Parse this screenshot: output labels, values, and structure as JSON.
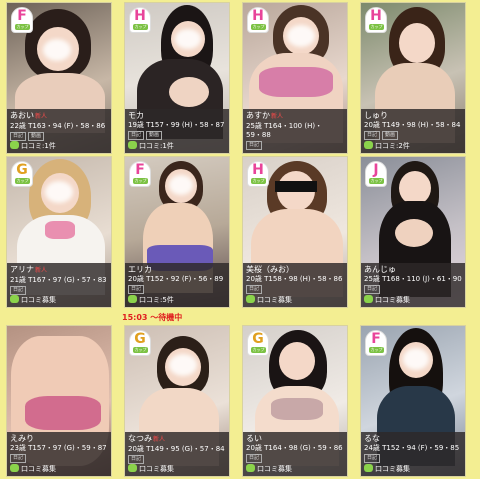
{
  "colors": {
    "background": "#f3ee92",
    "info_panel": "#3a3633",
    "badge_F": "#e8449a",
    "badge_G": "#e0a020",
    "badge_H": "#e8449a",
    "badge_J": "#e8449a",
    "new_mark": "#ff4a4a",
    "waiting": "#e02020"
  },
  "waiting_banner": {
    "text": "15:03 ～待機中"
  },
  "cast": [
    {
      "cup": "F",
      "cup_sub": "カップ",
      "name": "あおい",
      "new": "新人",
      "spec": "22歳 T163・94 (F)・58・86",
      "tags": [
        "日記",
        "動画"
      ],
      "reviews": "口コミ:1件"
    },
    {
      "cup": "H",
      "cup_sub": "カップ",
      "name": "モカ",
      "new": "",
      "spec": "19歳 T157・99 (H)・58・87",
      "tags": [
        "日記",
        "動画"
      ],
      "reviews": "口コミ:1件"
    },
    {
      "cup": "H",
      "cup_sub": "カップ",
      "name": "あすか",
      "new": "新人",
      "spec": "25歳 T164・100 (H)・59・88",
      "tags": [
        "日記"
      ],
      "reviews": ""
    },
    {
      "cup": "H",
      "cup_sub": "カップ",
      "name": "しゅり",
      "new": "",
      "spec": "20歳 T149・98 (H)・58・84",
      "tags": [
        "日記",
        "動画"
      ],
      "reviews": "口コミ:2件"
    },
    {
      "cup": "G",
      "cup_sub": "カップ",
      "name": "アリナ",
      "new": "新人",
      "spec": "21歳 T167・97 (G)・57・83",
      "tags": [
        "日記"
      ],
      "reviews": "口コミ募集"
    },
    {
      "cup": "F",
      "cup_sub": "カップ",
      "name": "エリカ",
      "new": "",
      "spec": "20歳 T152・92 (F)・56・89",
      "tags": [
        "日記"
      ],
      "reviews": "口コミ:5件"
    },
    {
      "cup": "H",
      "cup_sub": "カップ",
      "name": "美桜（みお）",
      "new": "",
      "spec": "20歳 T158・98 (H)・58・86",
      "tags": [
        "日記"
      ],
      "reviews": "口コミ募集"
    },
    {
      "cup": "J",
      "cup_sub": "カップ",
      "name": "あんじゅ",
      "new": "",
      "spec": "25歳 T168・110 (J)・61・90",
      "tags": [
        "日記"
      ],
      "reviews": "口コミ募集"
    },
    {
      "cup": "",
      "cup_sub": "",
      "name": "えみり",
      "new": "",
      "spec": "23歳 T157・97 (G)・59・87",
      "tags": [
        "日記"
      ],
      "reviews": "口コミ募集"
    },
    {
      "cup": "G",
      "cup_sub": "カップ",
      "name": "なつみ",
      "new": "新人",
      "spec": "20歳 T149・95 (G)・57・84",
      "tags": [
        "日記"
      ],
      "reviews": "口コミ募集"
    },
    {
      "cup": "G",
      "cup_sub": "カップ",
      "name": "るい",
      "new": "",
      "spec": "20歳 T164・98 (G)・59・86",
      "tags": [
        "日記"
      ],
      "reviews": "口コミ募集"
    },
    {
      "cup": "F",
      "cup_sub": "カップ",
      "name": "るな",
      "new": "",
      "spec": "24歳 T152・94 (F)・59・85",
      "tags": [
        "日記"
      ],
      "reviews": "口コミ募集"
    }
  ]
}
